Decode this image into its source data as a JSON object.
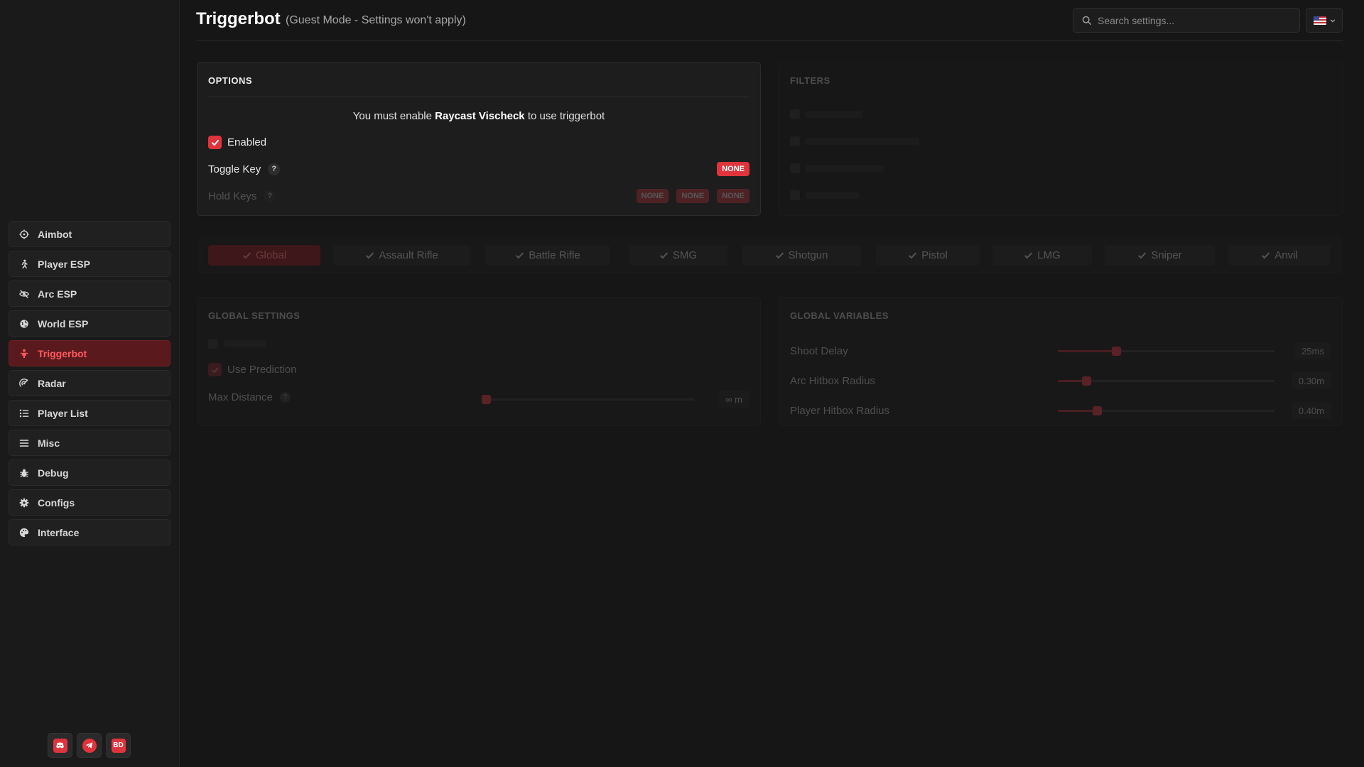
{
  "header": {
    "title": "Triggerbot",
    "subtitle": "(Guest Mode - Settings won't apply)",
    "search_placeholder": "Search settings..."
  },
  "sidebar": {
    "items": [
      {
        "label": "Aimbot",
        "icon": "crosshair-icon"
      },
      {
        "label": "Player ESP",
        "icon": "running-person-icon"
      },
      {
        "label": "Arc ESP",
        "icon": "eye-slash-icon"
      },
      {
        "label": "World ESP",
        "icon": "globe-icon"
      },
      {
        "label": "Triggerbot",
        "icon": "person-icon",
        "active": true
      },
      {
        "label": "Radar",
        "icon": "radar-icon"
      },
      {
        "label": "Player List",
        "icon": "list-icon"
      },
      {
        "label": "Misc",
        "icon": "menu-icon"
      },
      {
        "label": "Debug",
        "icon": "bug-icon"
      },
      {
        "label": "Configs",
        "icon": "gear-icon"
      },
      {
        "label": "Interface",
        "icon": "palette-icon"
      }
    ],
    "socials": [
      {
        "icon": "discord-icon"
      },
      {
        "icon": "telegram-icon"
      },
      {
        "icon": "bd-icon",
        "text": "BD"
      }
    ]
  },
  "options": {
    "title": "OPTIONS",
    "notice_prefix": "You must enable",
    "notice_bold": "Raycast Vischeck",
    "notice_suffix": "to use triggerbot",
    "enabled_label": "Enabled",
    "enabled": true,
    "toggle_key_label": "Toggle Key",
    "toggle_key_value": "NONE",
    "hold_keys_label": "Hold Keys",
    "hold_keys": [
      "NONE",
      "NONE",
      "NONE"
    ],
    "help_symbol": "?"
  },
  "filters": {
    "title": "FILTERS"
  },
  "weapon_tabs": [
    {
      "label": "Global",
      "active": true
    },
    {
      "label": "Assault Rifle"
    },
    {
      "label": "Battle Rifle"
    },
    {
      "label": "SMG"
    },
    {
      "label": "Shotgun"
    },
    {
      "label": "Pistol"
    },
    {
      "label": "LMG"
    },
    {
      "label": "Sniper"
    },
    {
      "label": "Anvil"
    }
  ],
  "global_settings": {
    "title": "GLOBAL SETTINGS",
    "use_prediction_label": "Use Prediction",
    "use_prediction": true,
    "max_distance_label": "Max Distance",
    "max_distance_value": "∞ m",
    "max_distance_fraction": 0.0
  },
  "global_variables": {
    "title": "GLOBAL VARIABLES",
    "sliders": [
      {
        "label": "Shoot Delay",
        "value": "25ms",
        "fraction": 0.27
      },
      {
        "label": "Arc Hitbox Radius",
        "value": "0.30m",
        "fraction": 0.13
      },
      {
        "label": "Player Hitbox Radius",
        "value": "0.40m",
        "fraction": 0.18
      }
    ]
  },
  "colors": {
    "accent": "#e0343d",
    "background": "#161616",
    "active_nav_bg": "#5a1a1d"
  }
}
